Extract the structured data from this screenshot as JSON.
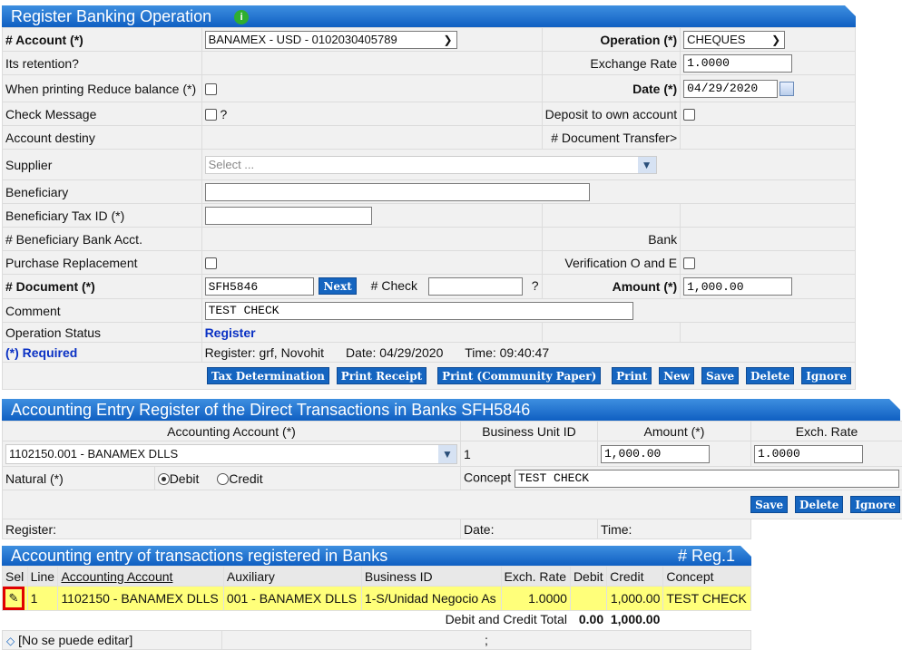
{
  "register": {
    "title": "Register Banking Operation",
    "account_label": "# Account (*)",
    "account_value": "BANAMEX - USD - 0102030405789",
    "operation_label": "Operation (*)",
    "operation_value": "CHEQUES",
    "retention_label": "Its retention?",
    "exchange_rate_label": "Exchange Rate",
    "exchange_rate_value": "1.0000",
    "reduce_balance_label": "When printing Reduce balance (*)",
    "date_label": "Date (*)",
    "date_value": "04/29/2020",
    "check_message_label": "Check Message",
    "check_message_help": "?",
    "deposit_own_label": "Deposit to own account",
    "account_destiny_label": "Account destiny",
    "doc_transfer_label": "# Document Transfer>",
    "supplier_label": "Supplier",
    "supplier_placeholder": "Select ...",
    "beneficiary_label": "Beneficiary",
    "beneficiary_tax_label": "Beneficiary Tax ID (*)",
    "beneficiary_bank_label": "# Beneficiary Bank Acct.",
    "bank_label": "Bank",
    "purchase_replacement_label": "Purchase Replacement",
    "verification_label": "Verification O and E",
    "document_label": "# Document (*)",
    "document_value": "SFH5846",
    "next_label": "Next",
    "check_label": "# Check",
    "check_help": "?",
    "amount_label": "Amount (*)",
    "amount_value": "1,000.00",
    "comment_label": "Comment",
    "comment_value": "TEST CHECK",
    "status_label": "Operation Status",
    "status_value": "Register",
    "required_label": "(*) Required",
    "register_info": "Register: grf, Novohit",
    "date_info": "Date: 04/29/2020",
    "time_info": "Time: 09:40:47",
    "buttons": [
      "Tax Determination",
      "Print Receipt",
      "Print (Community Paper)",
      "Print",
      "New",
      "Save",
      "Delete",
      "Ignore"
    ]
  },
  "entry": {
    "title": "Accounting Entry Register of the Direct Transactions in Banks SFH5846",
    "col_account": "Accounting Account (*)",
    "col_bu": "Business Unit ID",
    "col_amount": "Amount (*)",
    "col_rate": "Exch. Rate",
    "account_value": "1102150.001 - BANAMEX DLLS",
    "bu_value": "1",
    "amount_value": "1,000.00",
    "rate_value": "1.0000",
    "natural_label": "Natural (*)",
    "debit_label": "Debit",
    "credit_label": "Credit",
    "concept_label": "Concept",
    "concept_value": "TEST CHECK",
    "buttons": [
      "Save",
      "Delete",
      "Ignore"
    ],
    "register_label": "Register:",
    "date_label": "Date:",
    "time_label": "Time:"
  },
  "list": {
    "title": "Accounting entry of transactions registered in Banks",
    "reg_count": "# Reg.1",
    "headers": [
      "Sel",
      "Line",
      "Accounting Account",
      "Auxiliary",
      "Business ID",
      "Exch. Rate",
      "Debit",
      "Credit",
      "Concept"
    ],
    "row": {
      "line": "1",
      "account": "1102150 - BANAMEX DLLS",
      "auxiliary": "001 - BANAMEX DLLS",
      "business": "1-S/Unidad Negocio As",
      "rate": "1.0000",
      "debit": "",
      "credit": "1,000.00",
      "concept": "TEST CHECK"
    },
    "total_label": "Debit and Credit Total",
    "total_debit": "0.00",
    "total_credit": "1,000.00",
    "footer_note": "[No se puede editar]",
    "footer_sep": ";"
  },
  "colors": {
    "header_top": "#3e8fe0",
    "header_bottom": "#0f5fc2",
    "button": "#1565c0",
    "highlight_row": "#ffff7a",
    "selection_box": "#e00000"
  }
}
